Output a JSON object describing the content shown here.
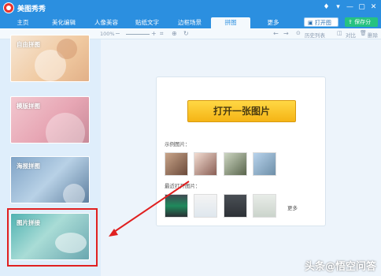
{
  "app": {
    "title": "美图秀秀",
    "window_controls": [
      "♦",
      "▾",
      "—",
      "▢",
      "✕"
    ]
  },
  "tabs": [
    {
      "label": "主页"
    },
    {
      "label": "美化编辑"
    },
    {
      "label": "人像美容"
    },
    {
      "label": "贴纸文字"
    },
    {
      "label": "边框场景"
    },
    {
      "label": "拼图",
      "active": true
    },
    {
      "label": "更多"
    }
  ],
  "actions": {
    "open_image": "打开图片",
    "save_share": "保存分享"
  },
  "toolbar": {
    "zoom": "100%",
    "history": "历史列表",
    "compare": "对比",
    "delete": "删除"
  },
  "left_panel": {
    "items": [
      {
        "label": "自由拼图"
      },
      {
        "label": "模版拼图"
      },
      {
        "label": "海报拼图"
      },
      {
        "label": "图片拼接"
      }
    ]
  },
  "main": {
    "open_one_image": "打开一张图片",
    "sample_label": "示例图片：",
    "recent_label": "最近打开图片：",
    "more": "更多"
  },
  "watermark": "头条@悟空问答",
  "colors": {
    "titlebar": "#2b8fe0",
    "open_button": "#f5b415",
    "highlight": "#e02020",
    "save_share": "#26c281"
  }
}
